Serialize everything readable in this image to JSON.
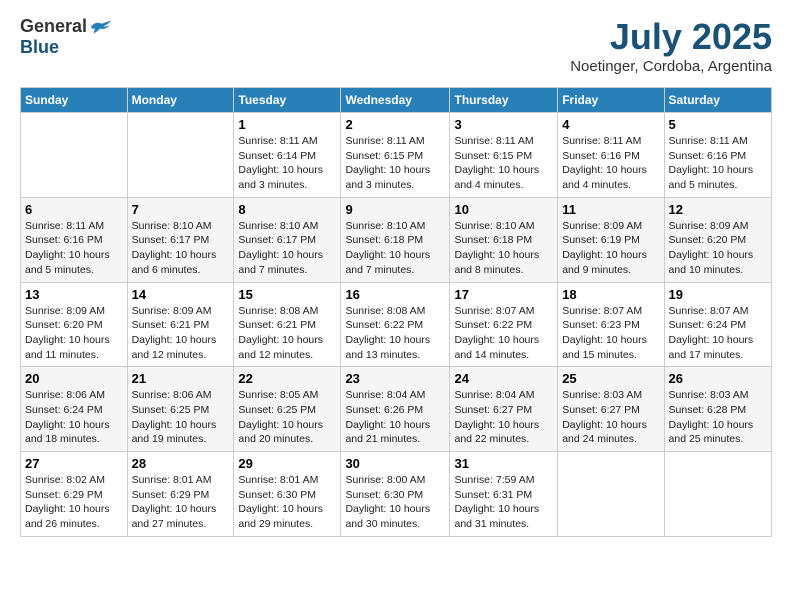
{
  "logo": {
    "general": "General",
    "blue": "Blue"
  },
  "header": {
    "month": "July 2025",
    "location": "Noetinger, Cordoba, Argentina"
  },
  "weekdays": [
    "Sunday",
    "Monday",
    "Tuesday",
    "Wednesday",
    "Thursday",
    "Friday",
    "Saturday"
  ],
  "weeks": [
    [
      {
        "day": "",
        "content": ""
      },
      {
        "day": "",
        "content": ""
      },
      {
        "day": "1",
        "content": "Sunrise: 8:11 AM\nSunset: 6:14 PM\nDaylight: 10 hours and 3 minutes."
      },
      {
        "day": "2",
        "content": "Sunrise: 8:11 AM\nSunset: 6:15 PM\nDaylight: 10 hours and 3 minutes."
      },
      {
        "day": "3",
        "content": "Sunrise: 8:11 AM\nSunset: 6:15 PM\nDaylight: 10 hours and 4 minutes."
      },
      {
        "day": "4",
        "content": "Sunrise: 8:11 AM\nSunset: 6:16 PM\nDaylight: 10 hours and 4 minutes."
      },
      {
        "day": "5",
        "content": "Sunrise: 8:11 AM\nSunset: 6:16 PM\nDaylight: 10 hours and 5 minutes."
      }
    ],
    [
      {
        "day": "6",
        "content": "Sunrise: 8:11 AM\nSunset: 6:16 PM\nDaylight: 10 hours and 5 minutes."
      },
      {
        "day": "7",
        "content": "Sunrise: 8:10 AM\nSunset: 6:17 PM\nDaylight: 10 hours and 6 minutes."
      },
      {
        "day": "8",
        "content": "Sunrise: 8:10 AM\nSunset: 6:17 PM\nDaylight: 10 hours and 7 minutes."
      },
      {
        "day": "9",
        "content": "Sunrise: 8:10 AM\nSunset: 6:18 PM\nDaylight: 10 hours and 7 minutes."
      },
      {
        "day": "10",
        "content": "Sunrise: 8:10 AM\nSunset: 6:18 PM\nDaylight: 10 hours and 8 minutes."
      },
      {
        "day": "11",
        "content": "Sunrise: 8:09 AM\nSunset: 6:19 PM\nDaylight: 10 hours and 9 minutes."
      },
      {
        "day": "12",
        "content": "Sunrise: 8:09 AM\nSunset: 6:20 PM\nDaylight: 10 hours and 10 minutes."
      }
    ],
    [
      {
        "day": "13",
        "content": "Sunrise: 8:09 AM\nSunset: 6:20 PM\nDaylight: 10 hours and 11 minutes."
      },
      {
        "day": "14",
        "content": "Sunrise: 8:09 AM\nSunset: 6:21 PM\nDaylight: 10 hours and 12 minutes."
      },
      {
        "day": "15",
        "content": "Sunrise: 8:08 AM\nSunset: 6:21 PM\nDaylight: 10 hours and 12 minutes."
      },
      {
        "day": "16",
        "content": "Sunrise: 8:08 AM\nSunset: 6:22 PM\nDaylight: 10 hours and 13 minutes."
      },
      {
        "day": "17",
        "content": "Sunrise: 8:07 AM\nSunset: 6:22 PM\nDaylight: 10 hours and 14 minutes."
      },
      {
        "day": "18",
        "content": "Sunrise: 8:07 AM\nSunset: 6:23 PM\nDaylight: 10 hours and 15 minutes."
      },
      {
        "day": "19",
        "content": "Sunrise: 8:07 AM\nSunset: 6:24 PM\nDaylight: 10 hours and 17 minutes."
      }
    ],
    [
      {
        "day": "20",
        "content": "Sunrise: 8:06 AM\nSunset: 6:24 PM\nDaylight: 10 hours and 18 minutes."
      },
      {
        "day": "21",
        "content": "Sunrise: 8:06 AM\nSunset: 6:25 PM\nDaylight: 10 hours and 19 minutes."
      },
      {
        "day": "22",
        "content": "Sunrise: 8:05 AM\nSunset: 6:25 PM\nDaylight: 10 hours and 20 minutes."
      },
      {
        "day": "23",
        "content": "Sunrise: 8:04 AM\nSunset: 6:26 PM\nDaylight: 10 hours and 21 minutes."
      },
      {
        "day": "24",
        "content": "Sunrise: 8:04 AM\nSunset: 6:27 PM\nDaylight: 10 hours and 22 minutes."
      },
      {
        "day": "25",
        "content": "Sunrise: 8:03 AM\nSunset: 6:27 PM\nDaylight: 10 hours and 24 minutes."
      },
      {
        "day": "26",
        "content": "Sunrise: 8:03 AM\nSunset: 6:28 PM\nDaylight: 10 hours and 25 minutes."
      }
    ],
    [
      {
        "day": "27",
        "content": "Sunrise: 8:02 AM\nSunset: 6:29 PM\nDaylight: 10 hours and 26 minutes."
      },
      {
        "day": "28",
        "content": "Sunrise: 8:01 AM\nSunset: 6:29 PM\nDaylight: 10 hours and 27 minutes."
      },
      {
        "day": "29",
        "content": "Sunrise: 8:01 AM\nSunset: 6:30 PM\nDaylight: 10 hours and 29 minutes."
      },
      {
        "day": "30",
        "content": "Sunrise: 8:00 AM\nSunset: 6:30 PM\nDaylight: 10 hours and 30 minutes."
      },
      {
        "day": "31",
        "content": "Sunrise: 7:59 AM\nSunset: 6:31 PM\nDaylight: 10 hours and 31 minutes."
      },
      {
        "day": "",
        "content": ""
      },
      {
        "day": "",
        "content": ""
      }
    ]
  ]
}
